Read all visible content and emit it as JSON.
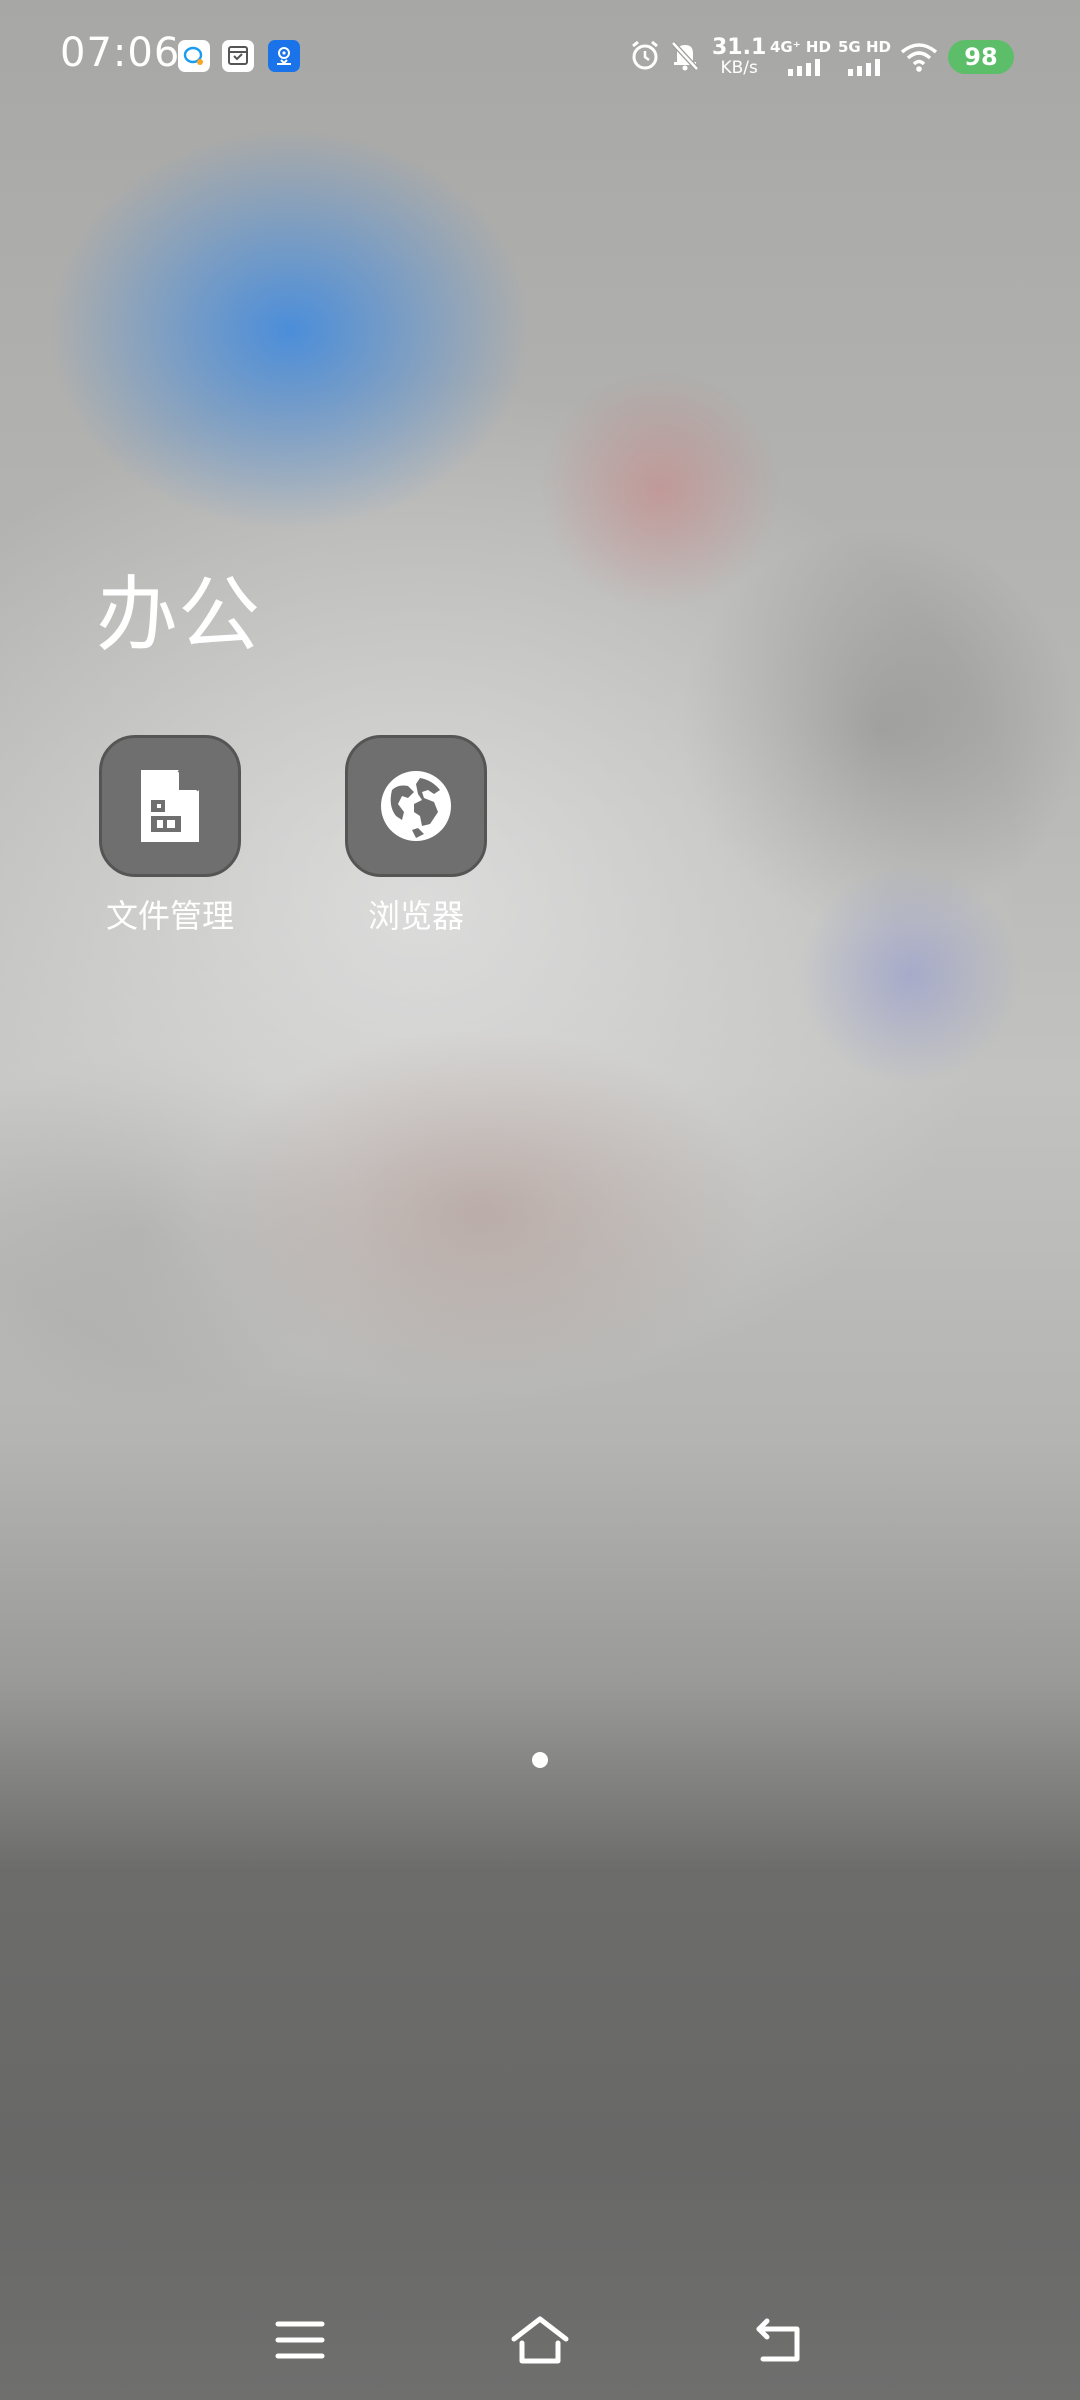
{
  "status_bar": {
    "time": "07:06",
    "net_speed_value": "31.1",
    "net_speed_unit": "KB/s",
    "sim1_label": "4G⁺ HD",
    "sim2_label": "5G HD",
    "battery": "98",
    "icons": [
      "chat-notification-icon",
      "inbox-notification-icon",
      "location-notification-icon",
      "alarm-icon",
      "mute-bell-icon",
      "signal-icon",
      "signal-icon",
      "wifi-icon"
    ],
    "battery_color": "#5dbe6a"
  },
  "folder": {
    "title": "办公",
    "apps": [
      {
        "label": "文件管理",
        "icon": "file-manager-icon"
      },
      {
        "label": "浏览器",
        "icon": "browser-globe-icon"
      }
    ]
  },
  "pager": {
    "current_page": 1,
    "total_pages": 1
  },
  "nav_bar": {
    "buttons": [
      "menu-icon",
      "home-icon",
      "back-icon"
    ]
  }
}
